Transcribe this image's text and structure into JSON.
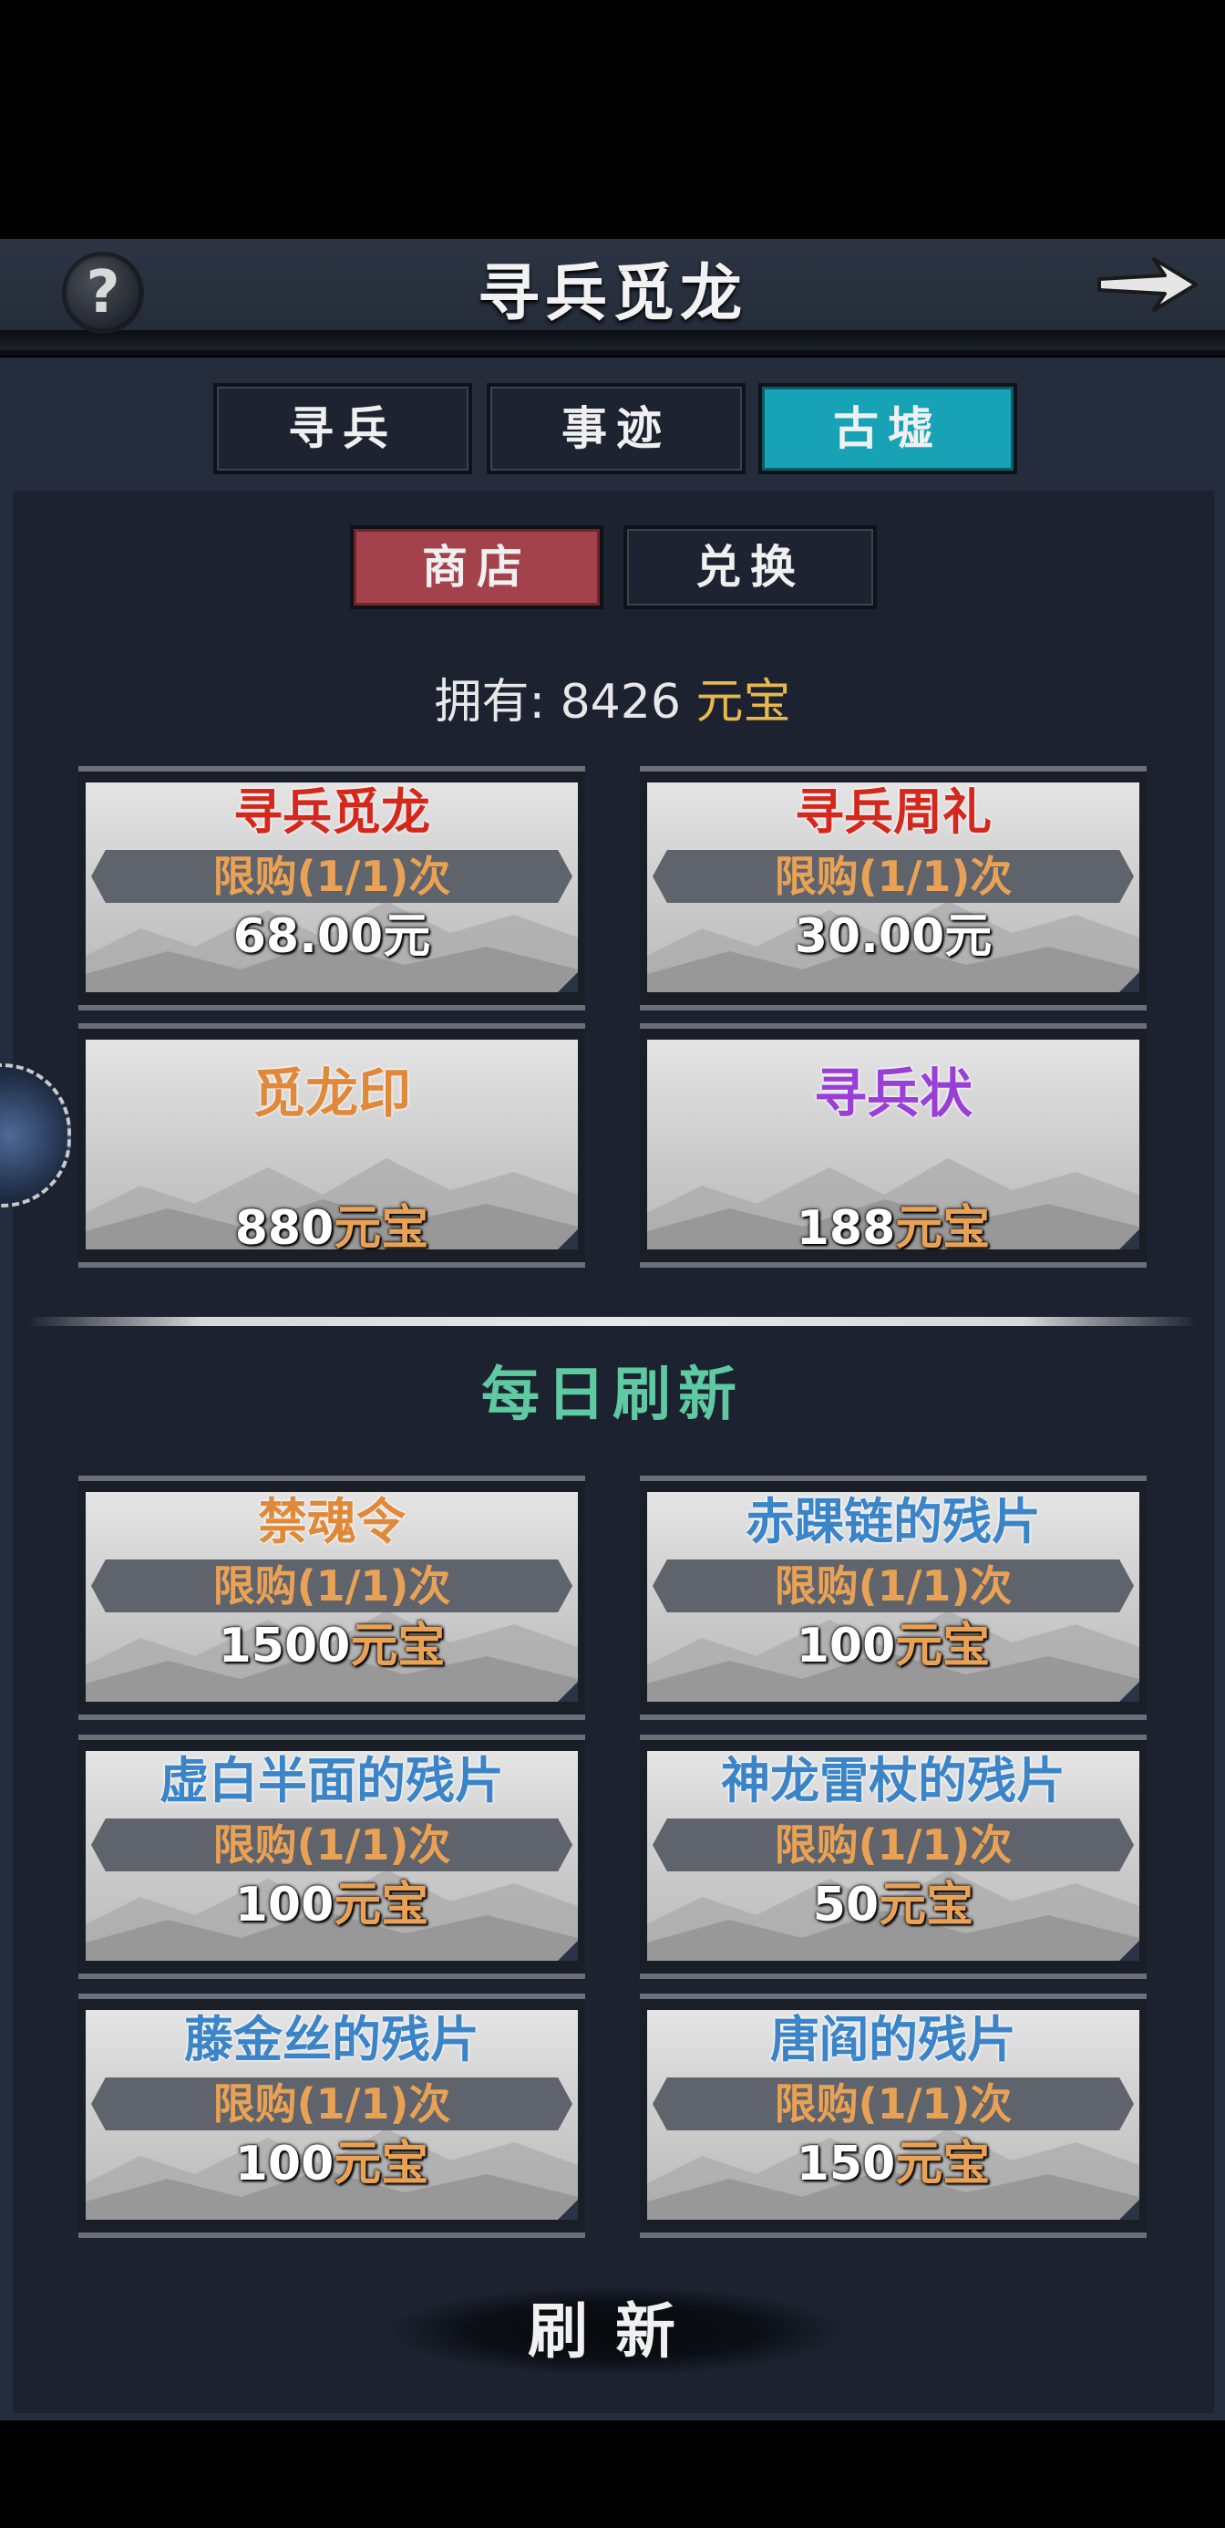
{
  "header": {
    "title": "寻兵觅龙",
    "help_icon": "question-mark-icon",
    "back_icon": "arrow-right-icon"
  },
  "tabs": [
    {
      "label": "寻兵",
      "active": false
    },
    {
      "label": "事迹",
      "active": false
    },
    {
      "label": "古墟",
      "active": true
    }
  ],
  "subtabs": [
    {
      "label": "商店",
      "active": true
    },
    {
      "label": "兑换",
      "active": false
    }
  ],
  "balance": {
    "prefix": "拥有:",
    "amount": "8426",
    "currency": "元宝"
  },
  "shop_items": [
    {
      "name": "寻兵觅龙",
      "limit": "限购(1/1)次",
      "price": "68.00元",
      "name_color": "#d4281c"
    },
    {
      "name": "寻兵周礼",
      "limit": "限购(1/1)次",
      "price": "30.00元",
      "name_color": "#d4281c"
    },
    {
      "name": "觅龙印",
      "price_num": "880",
      "price_unit": "元宝",
      "name_color": "#e0893a"
    },
    {
      "name": "寻兵状",
      "price_num": "188",
      "price_unit": "元宝",
      "name_color": "#9a3fd6"
    }
  ],
  "daily": {
    "title": "每日刷新",
    "items": [
      {
        "name": "禁魂令",
        "limit": "限购(1/1)次",
        "price_num": "1500",
        "price_unit": "元宝",
        "name_color": "#e0893a"
      },
      {
        "name": "赤踝链的残片",
        "limit": "限购(1/1)次",
        "price_num": "100",
        "price_unit": "元宝",
        "name_color": "#3b84c8"
      },
      {
        "name": "虚白半面的残片",
        "limit": "限购(1/1)次",
        "price_num": "100",
        "price_unit": "元宝",
        "name_color": "#3b84c8"
      },
      {
        "name": "神龙雷杖的残片",
        "limit": "限购(1/1)次",
        "price_num": "50",
        "price_unit": "元宝",
        "name_color": "#3b84c8"
      },
      {
        "name": "藤金丝的残片",
        "limit": "限购(1/1)次",
        "price_num": "100",
        "price_unit": "元宝",
        "name_color": "#3b84c8"
      },
      {
        "name": "唐阎的残片",
        "limit": "限购(1/1)次",
        "price_num": "150",
        "price_unit": "元宝",
        "name_color": "#3b84c8"
      }
    ]
  },
  "refresh_button": {
    "label": "刷新"
  }
}
